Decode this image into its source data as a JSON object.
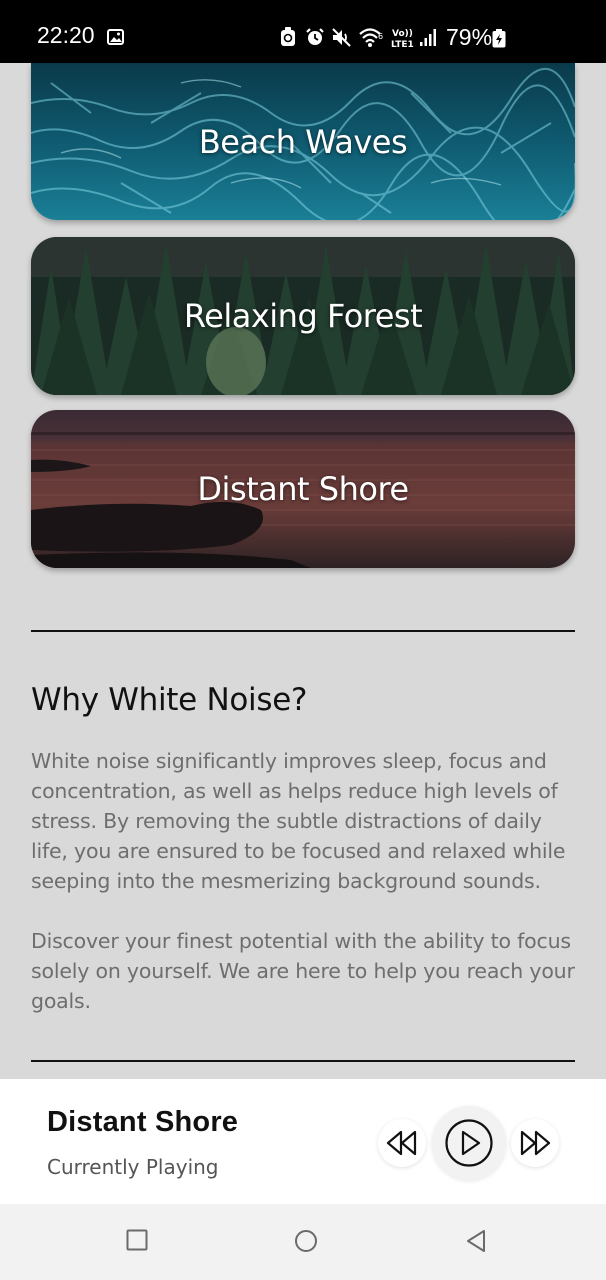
{
  "status_bar": {
    "time": "22:20",
    "battery_percent": "79%",
    "icons": [
      "image-icon",
      "recycle-icon",
      "alarm-icon",
      "mute-icon",
      "wifi-icon",
      "volte-icon",
      "signal-icon",
      "battery-icon"
    ],
    "volte_label": "Vo)) LTE1"
  },
  "cards": [
    {
      "label": "Beach Waves",
      "theme": "water"
    },
    {
      "label": "Relaxing Forest",
      "theme": "forest"
    },
    {
      "label": "Distant Shore",
      "theme": "shore"
    }
  ],
  "info": {
    "title": "Why White Noise?",
    "paragraph_1": "White noise significantly improves sleep, focus and concentration, as well as helps reduce high levels of stress. By removing the subtle distractions of daily life, you are ensured to be focused and relaxed while seeping into the mesmerizing background sounds.",
    "paragraph_2": "Discover your finest potential with the ability to focus solely on yourself. We are here to help you reach your goals."
  },
  "player": {
    "track_title": "Distant Shore",
    "status": "Currently Playing",
    "controls": [
      "rewind-icon",
      "play-icon",
      "fast-forward-icon"
    ]
  },
  "nav_bar": {
    "buttons": [
      "recents-icon",
      "home-icon",
      "back-icon"
    ]
  },
  "colors": {
    "background": "#d9d9d9",
    "text_primary": "#111111",
    "text_secondary": "#6e6e6e",
    "player_bg": "#ffffff"
  }
}
